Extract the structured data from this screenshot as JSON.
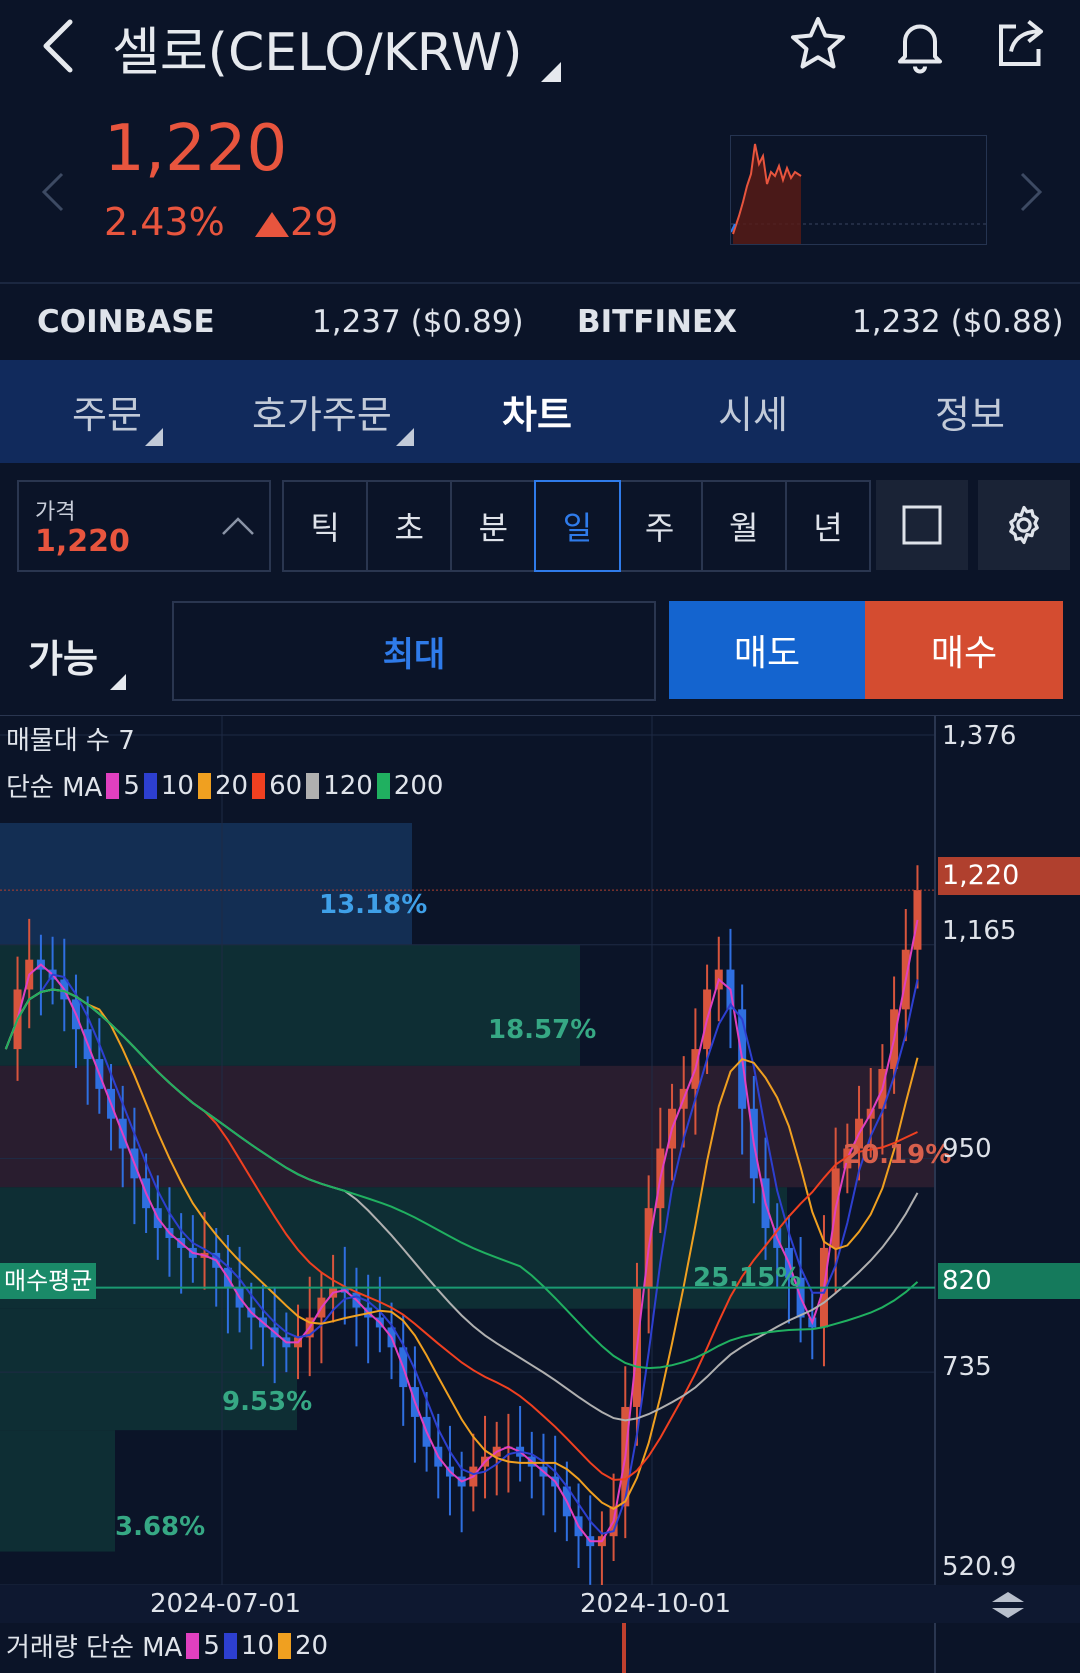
{
  "header": {
    "title": "셀로(CELO/KRW)",
    "icons": [
      "back-icon",
      "star-icon",
      "bell-icon",
      "share-icon"
    ]
  },
  "ticker": {
    "price": "1,220",
    "change_pct": "2.43%",
    "change_abs": "29",
    "color_up": "#e8553e"
  },
  "exchanges": [
    {
      "name": "COINBASE",
      "value": "1,237 ($0.89)"
    },
    {
      "name": "BITFINEX",
      "value": "1,232 ($0.88)"
    }
  ],
  "tabs": [
    {
      "label": "주문",
      "selected": false
    },
    {
      "label": "호가주문",
      "selected": false
    },
    {
      "label": "차트",
      "selected": true
    },
    {
      "label": "시세",
      "selected": false
    },
    {
      "label": "정보",
      "selected": false
    }
  ],
  "price_selector": {
    "label": "가격",
    "value": "1,220"
  },
  "periods": [
    {
      "label": "틱",
      "selected": false
    },
    {
      "label": "초",
      "selected": false
    },
    {
      "label": "분",
      "selected": false
    },
    {
      "label": "일",
      "selected": true
    },
    {
      "label": "주",
      "selected": false
    },
    {
      "label": "월",
      "selected": false
    },
    {
      "label": "년",
      "selected": false
    }
  ],
  "order_row": {
    "available_label": "가능",
    "max_label": "최대",
    "sell_label": "매도",
    "buy_label": "매수",
    "sell_color": "#1464cf",
    "buy_color": "#d44c30"
  },
  "chart_data": {
    "type": "candlestick",
    "volume_profile_label": "매물대 수 7",
    "ma_label": "단순 MA",
    "ma_series": [
      {
        "name": "5",
        "color": "#e040c0"
      },
      {
        "name": "10",
        "color": "#2d3fd0"
      },
      {
        "name": "20",
        "color": "#f0a020"
      },
      {
        "name": "60",
        "color": "#f04020"
      },
      {
        "name": "120",
        "color": "#b0b0b0"
      },
      {
        "name": "200",
        "color": "#20b060"
      }
    ],
    "y_ticks": [
      "1,376",
      "1,165",
      "950",
      "735",
      "520.9"
    ],
    "y_values": [
      1376,
      1165,
      950,
      735,
      520.9
    ],
    "ylim": [
      520.9,
      1376
    ],
    "current_price_label": "1,220",
    "current_price": 1220,
    "avg_buy_label": "매수평균",
    "avg_buy_value_label": "820",
    "avg_buy": 820,
    "x_ticks": [
      "2024-07-01",
      "2024-10-01"
    ],
    "volume_profile_pct": [
      "13.18%",
      "18.57%",
      "20.19%",
      "25.15%",
      "9.53%",
      "3.68%"
    ],
    "volume_label": "거래량 단순 MA",
    "volume_ma": [
      {
        "name": "5",
        "color": "#e040c0"
      },
      {
        "name": "10",
        "color": "#2d3fd0"
      },
      {
        "name": "20",
        "color": "#f0a020"
      }
    ],
    "close_series": [
      1060,
      1120,
      1150,
      1140,
      1130,
      1110,
      1080,
      1050,
      1020,
      990,
      960,
      930,
      900,
      880,
      870,
      860,
      850,
      855,
      840,
      820,
      800,
      790,
      780,
      770,
      760,
      770,
      790,
      810,
      820,
      815,
      800,
      790,
      780,
      760,
      720,
      690,
      660,
      640,
      630,
      620,
      640,
      650,
      660,
      660,
      650,
      640,
      630,
      620,
      590,
      570,
      560,
      570,
      600,
      700,
      820,
      900,
      960,
      1000,
      1020,
      1060,
      1120,
      1140,
      1100,
      1000,
      930,
      880,
      860,
      830,
      790,
      780,
      860,
      940,
      960,
      990,
      1000,
      1040,
      1100,
      1160,
      1220
    ]
  }
}
